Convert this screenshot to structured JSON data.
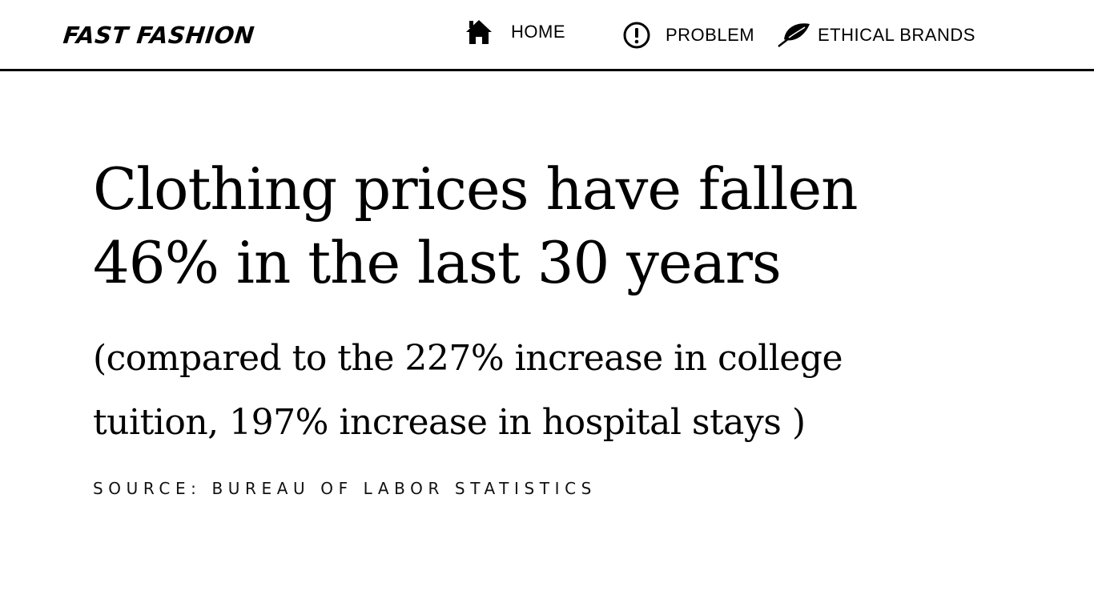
{
  "header": {
    "logo": "FAST FASHION",
    "nav": [
      {
        "label": "HOME",
        "icon": "home-icon"
      },
      {
        "label": "PROBLEM",
        "icon": "exclamation-circle-icon"
      },
      {
        "label": "ETHICAL BRANDS",
        "icon": "leaf-icon"
      }
    ]
  },
  "main": {
    "headline": "Clothing prices have fallen 46% in the last 30 years",
    "subline": "(compared to the 227% increase in college tuition, 197% increase in hospital stays )",
    "source": "SOURCE: BUREAU OF LABOR STATISTICS"
  },
  "colors": {
    "background": "#ffffff",
    "text": "#000000",
    "divider": "#000000"
  }
}
